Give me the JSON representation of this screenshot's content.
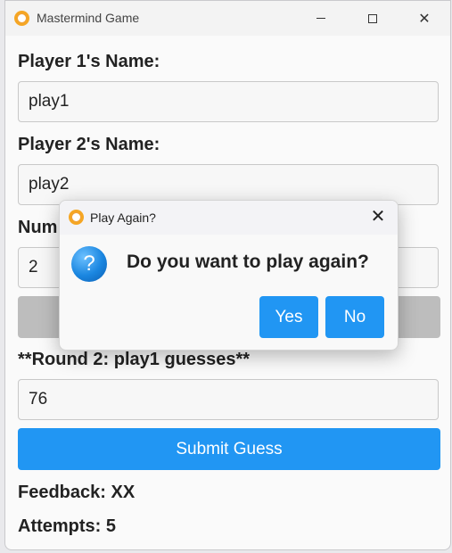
{
  "window": {
    "title": "Mastermind Game",
    "minimize_glyph": "",
    "maximize_glyph": "",
    "close_glyph": "✕"
  },
  "form": {
    "player1_label": "Player 1's Name:",
    "player1_value": "play1",
    "player2_label": "Player 2's Name:",
    "player2_value": "play2",
    "num_label": "Num",
    "num_value": "2",
    "round_label": "**Round 2: play1 guesses**",
    "guess_value": "76",
    "submit_label": "Submit Guess",
    "feedback_text": "Feedback: XX",
    "attempts_text": "Attempts: 5"
  },
  "dialog": {
    "title": "Play Again?",
    "close_glyph": "✕",
    "icon_glyph": "?",
    "message": "Do you want to play again?",
    "yes_label": "Yes",
    "no_label": "No"
  },
  "colors": {
    "accent": "#2196f3",
    "disabled_button": "#bdbdbd",
    "app_icon": "#f5a623"
  },
  "icons": {
    "app": "mastermind-logo-icon",
    "dialog": "question-icon"
  }
}
